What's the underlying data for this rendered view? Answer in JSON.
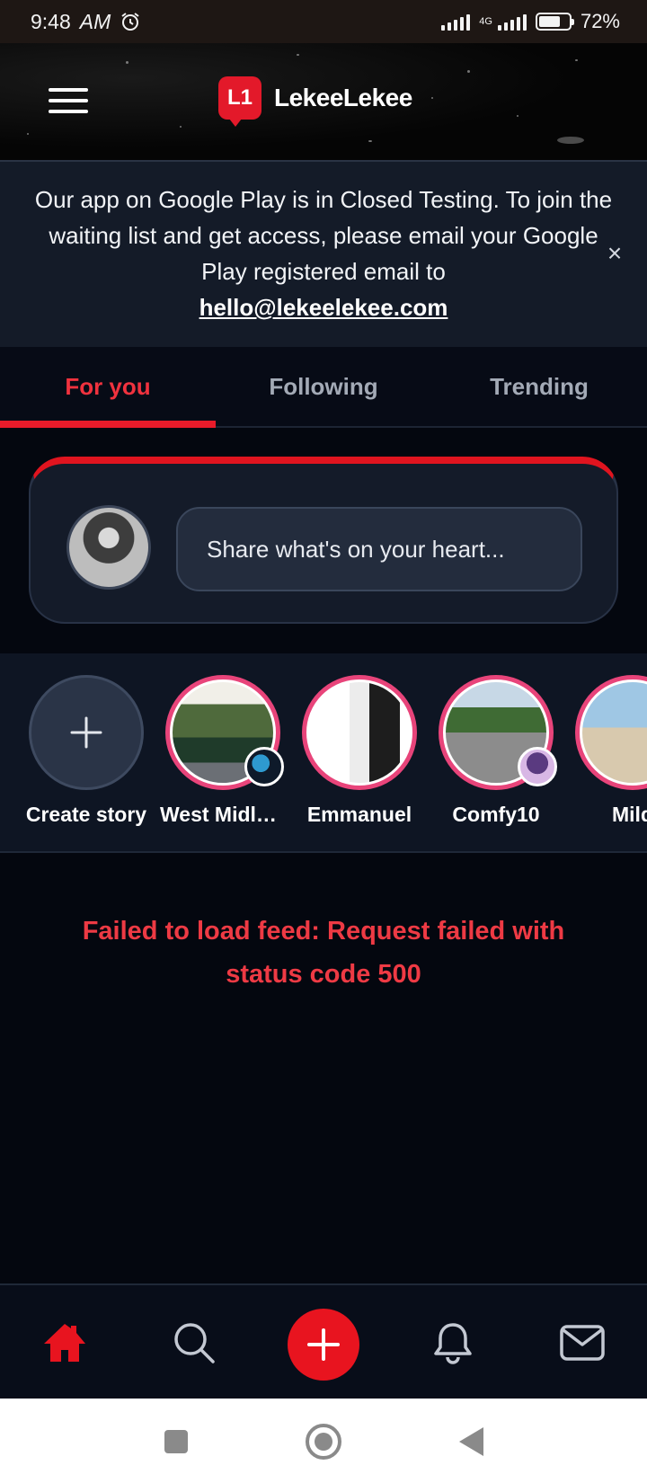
{
  "status_bar": {
    "time": "9:48",
    "meridiem": "AM",
    "network": "4G",
    "battery": "72%",
    "battery_level": 0.72
  },
  "header": {
    "logo_mark": "L1",
    "app_name": "LekeeLekee"
  },
  "banner": {
    "message": "Our app on Google Play is in Closed Testing. To join the waiting list and get access, please email your Google Play registered email to",
    "email": "hello@lekeelekee.com",
    "close_label": "×"
  },
  "tabs": [
    {
      "label": "For you",
      "active": true
    },
    {
      "label": "Following",
      "active": false
    },
    {
      "label": "Trending",
      "active": false
    }
  ],
  "composer": {
    "placeholder": "Share what's on your heart..."
  },
  "stories": [
    {
      "name": "Create story",
      "type": "create"
    },
    {
      "name": "West Midlands",
      "type": "story"
    },
    {
      "name": "Emmanuel",
      "type": "story"
    },
    {
      "name": "Comfy10",
      "type": "story"
    },
    {
      "name": "Mild",
      "type": "story"
    }
  ],
  "feed": {
    "error": "Failed to load feed: Request failed with status code 500"
  },
  "bottom_nav": [
    {
      "icon": "home-icon",
      "active": true
    },
    {
      "icon": "search-icon",
      "active": false
    },
    {
      "icon": "plus-icon",
      "active": false
    },
    {
      "icon": "bell-icon",
      "active": false
    },
    {
      "icon": "mail-icon",
      "active": false
    }
  ],
  "colors": {
    "accent": "#e8141f",
    "background": "#04070f",
    "banner": "#141b28",
    "error": "#ee3a44"
  }
}
